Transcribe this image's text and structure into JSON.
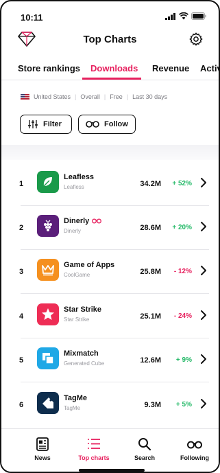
{
  "status_bar": {
    "time": "10:11"
  },
  "header": {
    "title": "Top Charts"
  },
  "tabs": [
    {
      "label": "Store rankings",
      "active": false
    },
    {
      "label": "Downloads",
      "active": true
    },
    {
      "label": "Revenue",
      "active": false
    },
    {
      "label": "Activ",
      "active": false
    }
  ],
  "filters": {
    "country": "United States",
    "category": "Overall",
    "price": "Free",
    "period": "Last 30 days"
  },
  "buttons": {
    "filter_label": "Filter",
    "follow_label": "Follow"
  },
  "apps": [
    {
      "rank": "1",
      "name": "Leafless",
      "developer": "Leafless",
      "value": "34.2M",
      "change": "+ 52%",
      "trend": "pos",
      "icon": "leaf-icon",
      "color": "#1a9a4a",
      "following": false
    },
    {
      "rank": "2",
      "name": "Dinerly",
      "developer": "Dinerly",
      "value": "28.6M",
      "change": "+ 20%",
      "trend": "pos",
      "icon": "grapes-icon",
      "color": "#5b1f7a",
      "following": true
    },
    {
      "rank": "3",
      "name": "Game of Apps",
      "developer": "CoolGame",
      "value": "25.8M",
      "change": "- 12%",
      "trend": "neg",
      "icon": "crown-icon",
      "color": "#f5901f",
      "following": false
    },
    {
      "rank": "4",
      "name": "Star Strike",
      "developer": "Star Strike",
      "value": "25.1M",
      "change": "- 24%",
      "trend": "neg",
      "icon": "star-icon",
      "color": "#ee2d55",
      "following": false
    },
    {
      "rank": "5",
      "name": "Mixmatch",
      "developer": "Generated Cube",
      "value": "12.6M",
      "change": "+ 9%",
      "trend": "pos",
      "icon": "squares-icon",
      "color": "#1fa8e6",
      "following": false
    },
    {
      "rank": "6",
      "name": "TagMe",
      "developer": "TagMe",
      "value": "9.3M",
      "change": "+ 5%",
      "trend": "pos",
      "icon": "tag-icon",
      "color": "#0e2d4d",
      "following": false
    }
  ],
  "bottom_nav": [
    {
      "label": "News",
      "icon": "news-icon",
      "active": false
    },
    {
      "label": "Top charts",
      "icon": "list-icon",
      "active": true
    },
    {
      "label": "Search",
      "icon": "search-icon",
      "active": false
    },
    {
      "label": "Following",
      "icon": "glasses-icon",
      "active": false
    }
  ],
  "colors": {
    "accent": "#e7205e",
    "positive": "#22b866",
    "negative": "#e7205e"
  }
}
